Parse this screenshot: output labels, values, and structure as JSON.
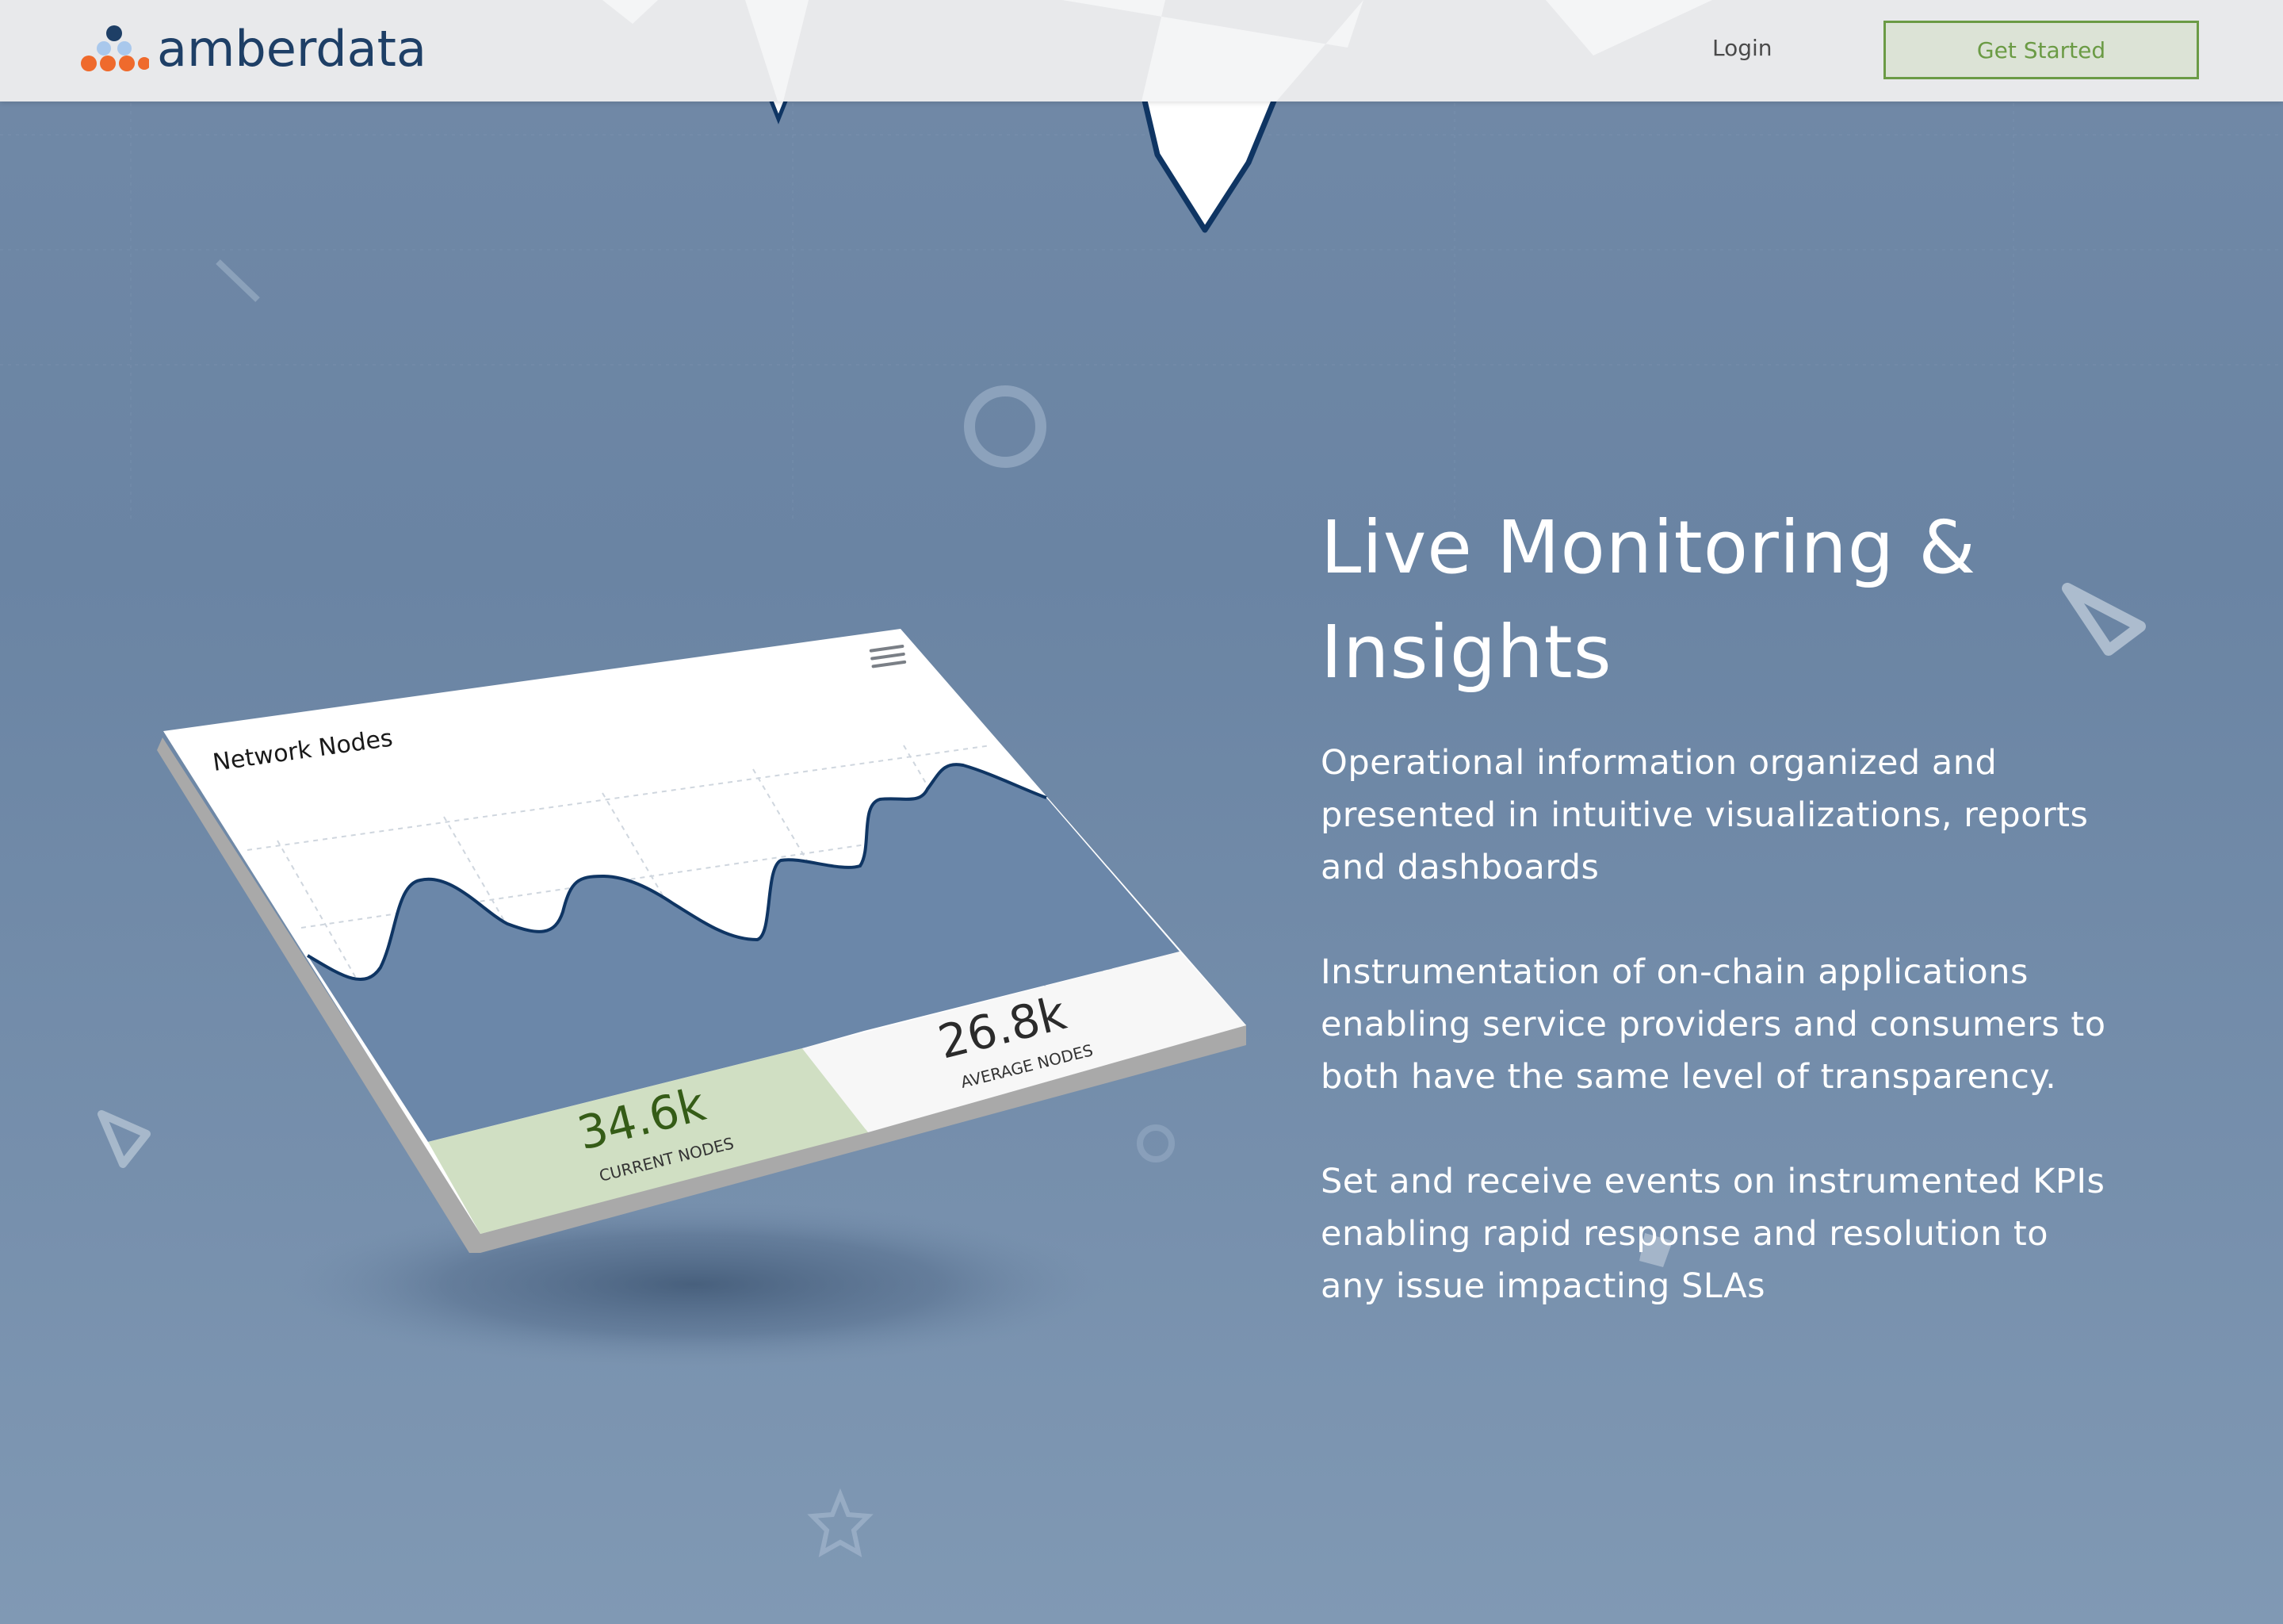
{
  "header": {
    "brand": "amberdata",
    "login_label": "Login",
    "cta_label": "Get Started"
  },
  "widget": {
    "title": "Network Nodes",
    "current_value": "34.6k",
    "current_label": "CURRENT NODES",
    "average_value": "26.8k",
    "average_label": "AVERAGE NODES",
    "menu_icon": "hamburger-icon"
  },
  "content": {
    "headline_line1": "Live Monitoring &",
    "headline_line2": "Insights",
    "paragraphs": [
      "Operational information organized and presented in intuitive visualizations, reports and dashboards",
      "Instrumentation of on-chain applications enabling service providers and consumers to both have the same level of transparency.",
      "Set and receive events on instrumented KPIs enabling rapid response and resolution to any issue impacting SLAs"
    ]
  },
  "colors": {
    "brand_navy": "#1e3f66",
    "brand_orange": "#ef6a2c",
    "cta_green": "#6b9b45",
    "current_tile": "#d0dfc3",
    "background": "#6f88a6"
  }
}
